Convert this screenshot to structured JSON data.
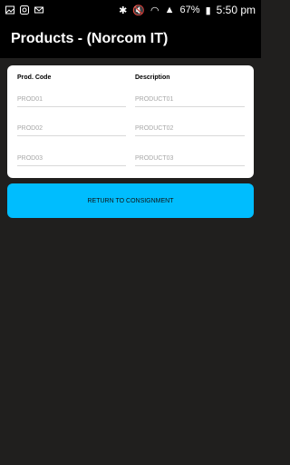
{
  "status_bar": {
    "battery": "67%",
    "time": "5:50 pm"
  },
  "header": {
    "title": "Products - (Norcom IT)"
  },
  "table": {
    "columns": [
      "Prod. Code",
      "Description"
    ],
    "rows": [
      {
        "code": "PROD01",
        "description": "PRODUCT01"
      },
      {
        "code": "PROD02",
        "description": "PRODUCT02"
      },
      {
        "code": "PROD03",
        "description": "PRODUCT03"
      }
    ]
  },
  "actions": {
    "return_label": "RETURN TO CONSIGNMENT"
  },
  "colors": {
    "accent": "#00bdfe",
    "background": "#201f1e",
    "card": "#ffffff"
  }
}
